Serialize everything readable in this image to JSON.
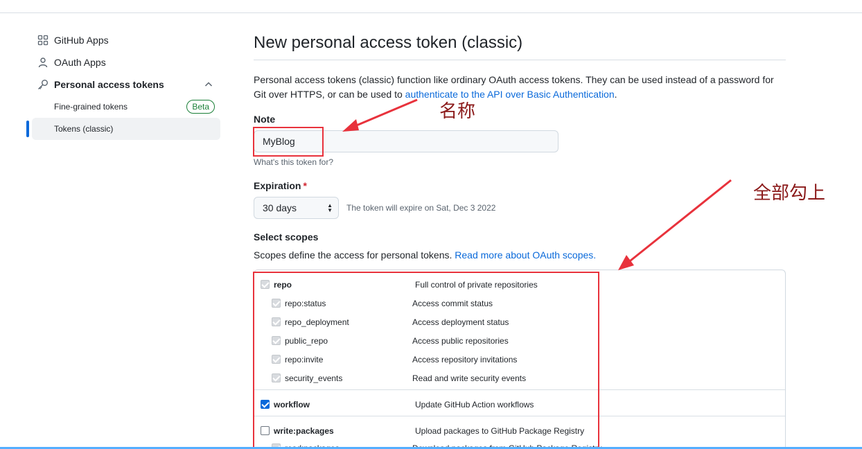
{
  "sidebar": {
    "items": [
      {
        "label": "GitHub Apps",
        "icon": "apps-grid-icon"
      },
      {
        "label": "OAuth Apps",
        "icon": "person-icon"
      },
      {
        "label": "Personal access tokens",
        "icon": "key-icon"
      }
    ],
    "sub_items": [
      {
        "label": "Fine-grained tokens",
        "badge": "Beta"
      },
      {
        "label": "Tokens (classic)",
        "active": true
      }
    ]
  },
  "main": {
    "title": "New personal access token (classic)",
    "intro_text": "Personal access tokens (classic) function like ordinary OAuth access tokens. They can be used instead of a password for Git over HTTPS, or can be used to ",
    "intro_link": "authenticate to the API over Basic Authentication",
    "intro_end": ".",
    "note": {
      "label": "Note",
      "value": "MyBlog",
      "hint": "What's this token for?"
    },
    "expiration": {
      "label": "Expiration",
      "required_mark": "*",
      "selected": "30 days",
      "note": "The token will expire on Sat, Dec 3 2022"
    },
    "scopes": {
      "label": "Select scopes",
      "desc": "Scopes define the access for personal tokens. ",
      "desc_link": "Read more about OAuth scopes.",
      "rows": [
        {
          "name": "repo",
          "desc": "Full control of private repositories"
        },
        {
          "name": "repo:status",
          "desc": "Access commit status"
        },
        {
          "name": "repo_deployment",
          "desc": "Access deployment status"
        },
        {
          "name": "public_repo",
          "desc": "Access public repositories"
        },
        {
          "name": "repo:invite",
          "desc": "Access repository invitations"
        },
        {
          "name": "security_events",
          "desc": "Read and write security events"
        },
        {
          "name": "workflow",
          "desc": "Update GitHub Action workflows"
        },
        {
          "name": "write:packages",
          "desc": "Upload packages to GitHub Package Registry"
        },
        {
          "name": "read:packages",
          "desc": "Download packages from GitHub Package Registry"
        }
      ]
    }
  },
  "annotations": {
    "name_label": "名称",
    "check_all_label": "全部勾上"
  },
  "colors": {
    "accent": "#0969da",
    "annotation_red": "#e8323c",
    "annotation_text": "#8b1a1a",
    "beta_green": "#1a7f37"
  }
}
